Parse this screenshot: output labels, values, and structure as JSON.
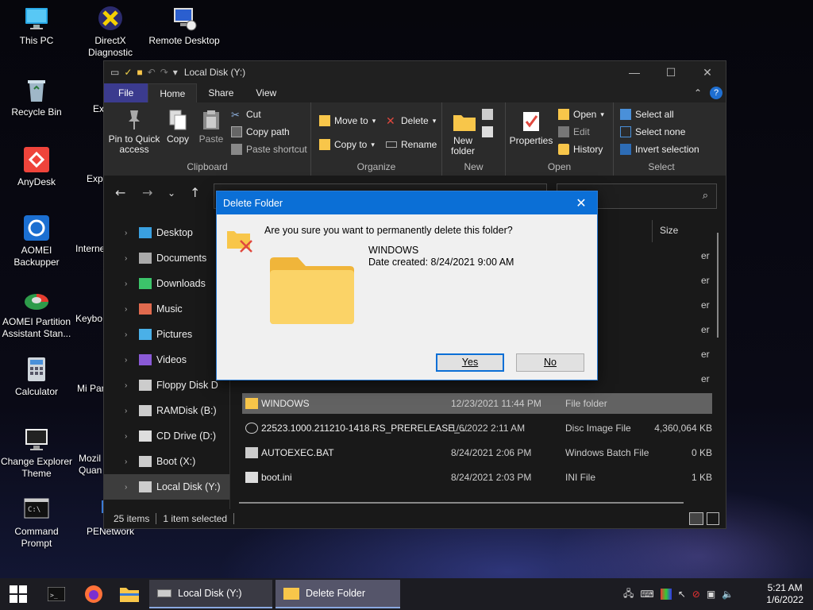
{
  "desktop": {
    "icons": [
      {
        "label": "This PC"
      },
      {
        "label": "DirectX Diagnostic"
      },
      {
        "label": "Remote Desktop"
      },
      {
        "label": "Recycle Bin"
      },
      {
        "label": "AnyDesk"
      },
      {
        "label": "AOMEI Backupper"
      },
      {
        "label": "AOMEI Partition Assistant Stan..."
      },
      {
        "label": "Calculator"
      },
      {
        "label": "Change Explorer Theme"
      },
      {
        "label": "Command Prompt"
      },
      {
        "label": "Ex"
      },
      {
        "label": "Expl"
      },
      {
        "label": "Interne"
      },
      {
        "label": "Keybo"
      },
      {
        "label": "Mi Partiti"
      },
      {
        "label": "Mozil Quan"
      },
      {
        "label": "PENetwork"
      }
    ]
  },
  "explorer": {
    "title": "Local Disk (Y:)",
    "tabs": {
      "file": "File",
      "home": "Home",
      "share": "Share",
      "view": "View"
    },
    "ribbon": {
      "clipboard": {
        "label": "Clipboard",
        "pin": "Pin to Quick access",
        "copy": "Copy",
        "paste": "Paste",
        "cut": "Cut",
        "copy_path": "Copy path",
        "paste_shortcut": "Paste shortcut"
      },
      "organize": {
        "label": "Organize",
        "move_to": "Move to",
        "copy_to": "Copy to",
        "delete": "Delete",
        "rename": "Rename"
      },
      "new": {
        "label": "New",
        "new_folder": "New folder"
      },
      "open": {
        "label": "Open",
        "properties": "Properties",
        "open": "Open",
        "edit": "Edit",
        "history": "History"
      },
      "select": {
        "label": "Select",
        "select_all": "Select all",
        "select_none": "Select none",
        "invert": "Invert selection"
      }
    },
    "nav": [
      {
        "label": "Desktop",
        "icon": "desktop-icon"
      },
      {
        "label": "Documents",
        "icon": "documents-icon"
      },
      {
        "label": "Downloads",
        "icon": "downloads-icon"
      },
      {
        "label": "Music",
        "icon": "music-icon"
      },
      {
        "label": "Pictures",
        "icon": "pictures-icon"
      },
      {
        "label": "Videos",
        "icon": "videos-icon"
      },
      {
        "label": "Floppy Disk D",
        "icon": "drive-icon"
      },
      {
        "label": "RAMDisk (B:)",
        "icon": "drive-icon"
      },
      {
        "label": "CD Drive (D:)",
        "icon": "cd-drive-icon"
      },
      {
        "label": "Boot (X:)",
        "icon": "drive-icon"
      },
      {
        "label": "Local Disk (Y:)",
        "icon": "drive-icon"
      }
    ],
    "columns": {
      "size": "Size"
    },
    "hidden_type_fragments": [
      "er",
      "er",
      "er",
      "er",
      "er",
      "er"
    ],
    "files": [
      {
        "name": "WINDOWS",
        "date": "12/23/2021 11:44 PM",
        "type": "File folder",
        "size": ""
      },
      {
        "name": "22523.1000.211210-1418.RS_PRERELEASE_...",
        "date": "1/6/2022 2:11 AM",
        "type": "Disc Image File",
        "size": "4,360,064 KB"
      },
      {
        "name": "AUTOEXEC.BAT",
        "date": "8/24/2021 2:06 PM",
        "type": "Windows Batch File",
        "size": "0 KB"
      },
      {
        "name": "boot.ini",
        "date": "8/24/2021 2:03 PM",
        "type": "INI File",
        "size": "1 KB"
      }
    ],
    "status": {
      "items": "25 items",
      "selected": "1 item selected"
    }
  },
  "dialog": {
    "title": "Delete Folder",
    "question": "Are you sure you want to permanently delete this folder?",
    "folder_name": "WINDOWS",
    "date_created": "Date created: 8/24/2021 9:00 AM",
    "yes": "Yes",
    "no": "No"
  },
  "taskbar": {
    "tasks": [
      {
        "label": "Local Disk (Y:)"
      },
      {
        "label": "Delete Folder"
      }
    ],
    "time": "5:21 AM",
    "date": "1/6/2022"
  },
  "colors": {
    "accent": "#0b6fd6",
    "file_tab": "#3b3b8e",
    "folder_yellow": "#f8c64a"
  }
}
